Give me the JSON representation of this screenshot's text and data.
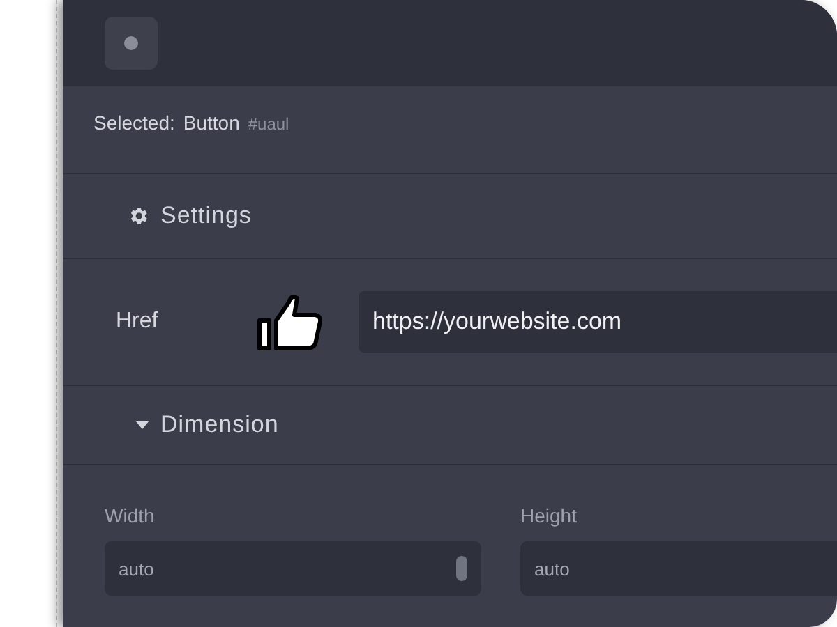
{
  "selection": {
    "label": "Selected:",
    "element": "Button",
    "id": "#uaul"
  },
  "settings": {
    "title": "Settings",
    "fields": [
      {
        "label": "Href",
        "value": "https://yourwebsite.com"
      }
    ]
  },
  "dimension": {
    "title": "Dimension",
    "expanded": true,
    "fields": [
      {
        "label": "Width",
        "placeholder": "auto",
        "kind": "stepper"
      },
      {
        "label": "Height",
        "placeholder": "auto",
        "kind": "plain"
      }
    ]
  }
}
